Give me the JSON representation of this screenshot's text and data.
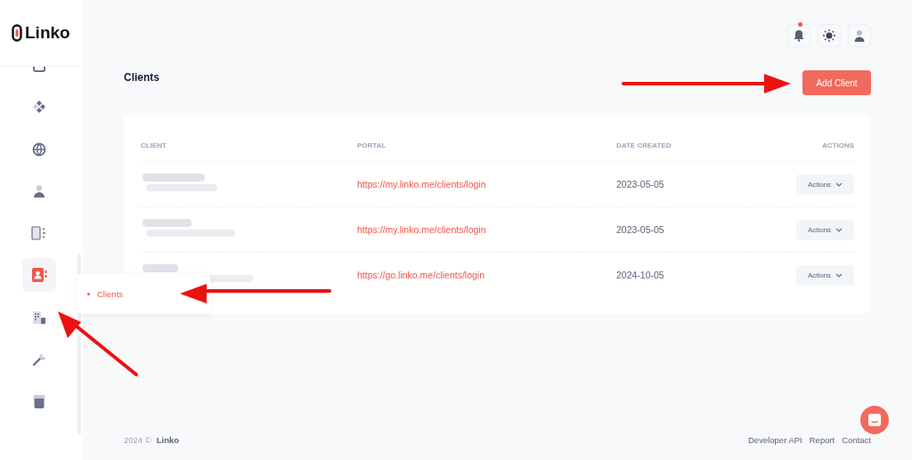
{
  "brand": {
    "name": "Linko"
  },
  "sidebar": {
    "items": [
      {
        "selected": false
      },
      {
        "selected": false
      },
      {
        "selected": false
      },
      {
        "selected": false
      },
      {
        "selected": false
      },
      {
        "selected": true
      },
      {
        "selected": false
      },
      {
        "selected": false
      },
      {
        "selected": false
      }
    ],
    "submenu": {
      "items": [
        {
          "label": "Clients",
          "selected": true
        }
      ]
    }
  },
  "header": {
    "notifications": {
      "unread": true
    }
  },
  "page": {
    "title": "Clients",
    "add_button": "Add Client"
  },
  "table": {
    "columns": [
      "CLIENT",
      "PORTAL",
      "DATE CREATED",
      "ACTIONS"
    ],
    "rows": [
      {
        "portal": "https://my.linko.me/clients/login",
        "date_created": "2023-05-05",
        "action": "Actions"
      },
      {
        "portal": "https://my.linko.me/clients/login",
        "date_created": "2023-05-05",
        "action": "Actions"
      },
      {
        "portal": "https://go.linko.me/clients/login",
        "date_created": "2024-10-05",
        "action": "Actions"
      }
    ]
  },
  "footer": {
    "year": "2024 ©",
    "brand": "Linko",
    "links": [
      "Developer API",
      "Report",
      "Contact"
    ]
  }
}
